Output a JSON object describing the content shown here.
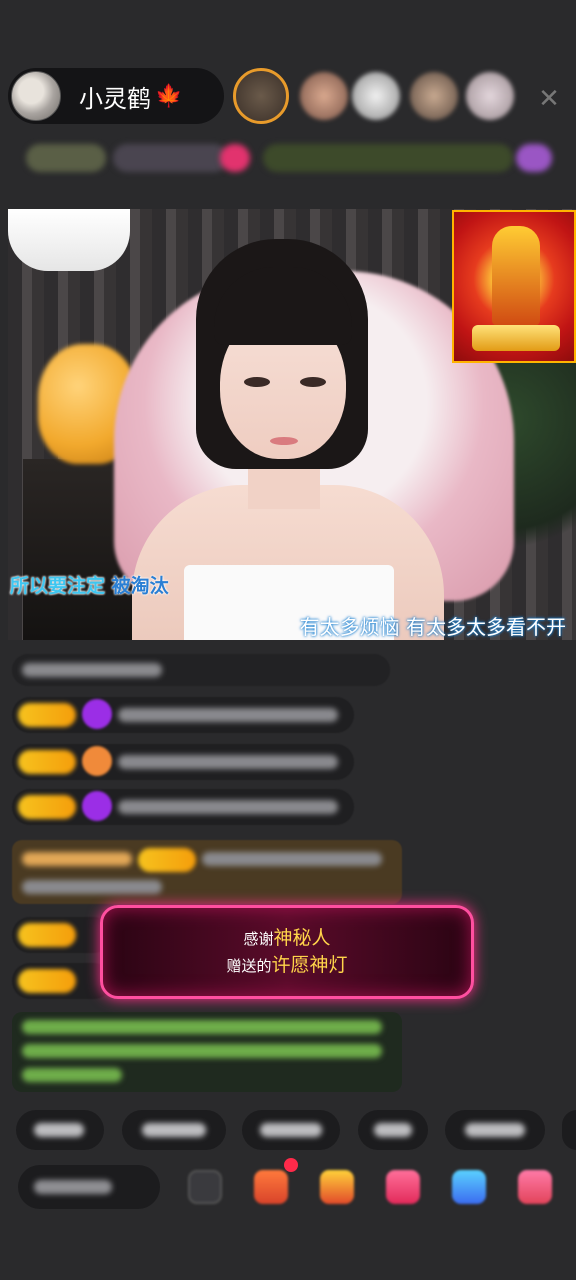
{
  "host": {
    "name": "小灵鹤",
    "name_icon": "maple-leaf-icon"
  },
  "viewers": [
    "viewer-1",
    "viewer-2",
    "viewer-3",
    "viewer-4",
    "viewer-5"
  ],
  "close_icon": "close-icon",
  "lyrics": {
    "left_part1": "所以要注定 ",
    "left_part2": "被淘汰",
    "right": "有太多烦恼  有太多太多看不开"
  },
  "gift_toast": {
    "thanks": "感谢",
    "sender": "神秘人",
    "sent": "赠送的",
    "gift": "许愿神灯"
  },
  "colors": {
    "accent_pink": "#ff4fa0",
    "gold": "#ffd44a",
    "level_badge": "#f6c21e",
    "lyric_blue": "#3ec6f0"
  }
}
